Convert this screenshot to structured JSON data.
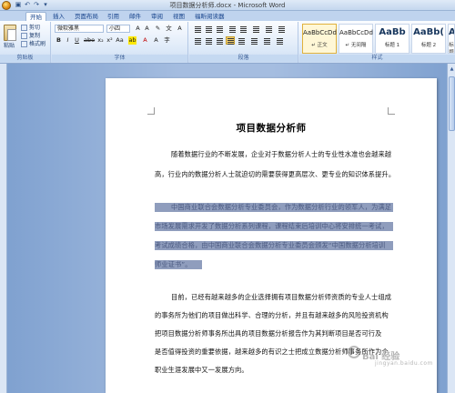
{
  "window": {
    "title": "项目数据分析师.docx - Microsoft Word"
  },
  "tabs": [
    "开始",
    "插入",
    "页面布局",
    "引用",
    "邮件",
    "审阅",
    "视图",
    "福昕阅读器"
  ],
  "ribbon": {
    "clipboard": {
      "paste": "粘贴",
      "cut": "剪切",
      "copy": "复制",
      "format_painter": "格式刷",
      "label": "剪贴板"
    },
    "font": {
      "name": "微软雅黑",
      "size": "小四",
      "label": "字体"
    },
    "paragraph": {
      "label": "段落"
    },
    "styles": {
      "label": "样式",
      "items": [
        {
          "sample": "AaBbCcDd",
          "name": "↵ 正文"
        },
        {
          "sample": "AaBbCcDd",
          "name": "↵ 无间隔"
        },
        {
          "sample": "AaBb",
          "name": "标题 1"
        },
        {
          "sample": "AaBb(",
          "name": "标题 2"
        },
        {
          "sample": "AaBb",
          "name": "标题"
        }
      ]
    }
  },
  "document": {
    "title": "项目数据分析师",
    "lines": [
      "随着数据行业的不断发展，企业对于数据分析人士的专业性水准也会越来越",
      "高，行业内的数据分析人士就迫切的需要获得更高层次、更专业的知识体系提升。",
      "中国商业联合会数据分析专业委员会，作为数据分析行业的领军人，为满足",
      "市场发展需求开发了数据分析系列课程，课程结束后培训中心将安排统一考试，",
      "考试成绩合格，由中国商业联合会数据分析专业委员会颁发“中国数据分析培训",
      "师业证书”。",
      "目前，已经有越来越多的企业选择拥有项目数据分析师资质的专业人士组成",
      "的事务所为他们的项目做出科学、合理的分析，并且有越来越多的风险投资机构",
      "把项目数据分析师事务所出具的项目数据分析报告作为其判断项目是否可行及",
      "是否值得投资的重要依据，越来越多的有识之士把成立数据分析师事务所作为个",
      "职业生涯发展中又一发展方向。"
    ]
  },
  "watermark": {
    "text": "Bai 经验",
    "sub": "jingyan.baidu.com"
  }
}
